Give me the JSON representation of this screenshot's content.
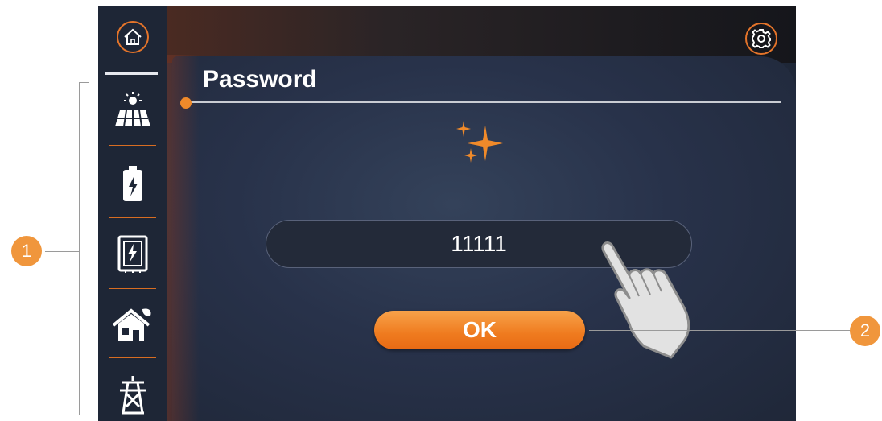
{
  "screen": {
    "title": "Password",
    "password_value": "11111",
    "ok_label": "OK"
  },
  "sidebar": {
    "items": [
      {
        "icon": "home-icon"
      },
      {
        "icon": "solar-panel-icon"
      },
      {
        "icon": "battery-icon"
      },
      {
        "icon": "inverter-icon"
      },
      {
        "icon": "house-load-icon"
      },
      {
        "icon": "grid-tower-icon"
      }
    ]
  },
  "header": {
    "settings_icon": "gear-icon"
  },
  "callouts": [
    "1",
    "2"
  ],
  "colors": {
    "accent": "#f08a2a",
    "sidebar_bg": "#1e2636",
    "screen_bg": "#28324a"
  }
}
